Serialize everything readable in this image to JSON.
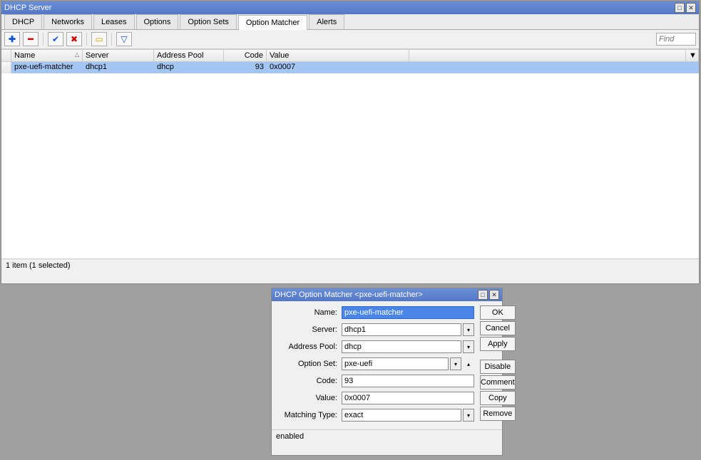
{
  "main": {
    "title": "DHCP Server",
    "tabs": [
      "DHCP",
      "Networks",
      "Leases",
      "Options",
      "Option Sets",
      "Option Matcher",
      "Alerts"
    ],
    "active_tab": 5,
    "find_placeholder": "Find",
    "columns": [
      "Name",
      "Server",
      "Address Pool",
      "Code",
      "Value"
    ],
    "rows": [
      {
        "name": "pxe-uefi-matcher",
        "server": "dhcp1",
        "pool": "dhcp",
        "code": "93",
        "value": "0x0007"
      }
    ],
    "status": "1 item (1 selected)"
  },
  "dialog": {
    "title": "DHCP Option Matcher <pxe-uefi-matcher>",
    "fields": {
      "name_label": "Name:",
      "name": "pxe-uefi-matcher",
      "server_label": "Server:",
      "server": "dhcp1",
      "pool_label": "Address Pool:",
      "pool": "dhcp",
      "optset_label": "Option Set:",
      "optset": "pxe-uefi",
      "code_label": "Code:",
      "code": "93",
      "value_label": "Value:",
      "value": "0x0007",
      "mtype_label": "Matching Type:",
      "mtype": "exact"
    },
    "buttons": {
      "ok": "OK",
      "cancel": "Cancel",
      "apply": "Apply",
      "disable": "Disable",
      "comment": "Comment",
      "copy": "Copy",
      "remove": "Remove"
    },
    "status": "enabled"
  },
  "icons": {
    "plus": "✚",
    "minus": "━",
    "check": "✔",
    "x": "✖",
    "note": "▭",
    "filter": "▽",
    "maximize": "□",
    "close": "✕",
    "dropdown": "▾",
    "collapse": "▴",
    "sort": "▲"
  }
}
